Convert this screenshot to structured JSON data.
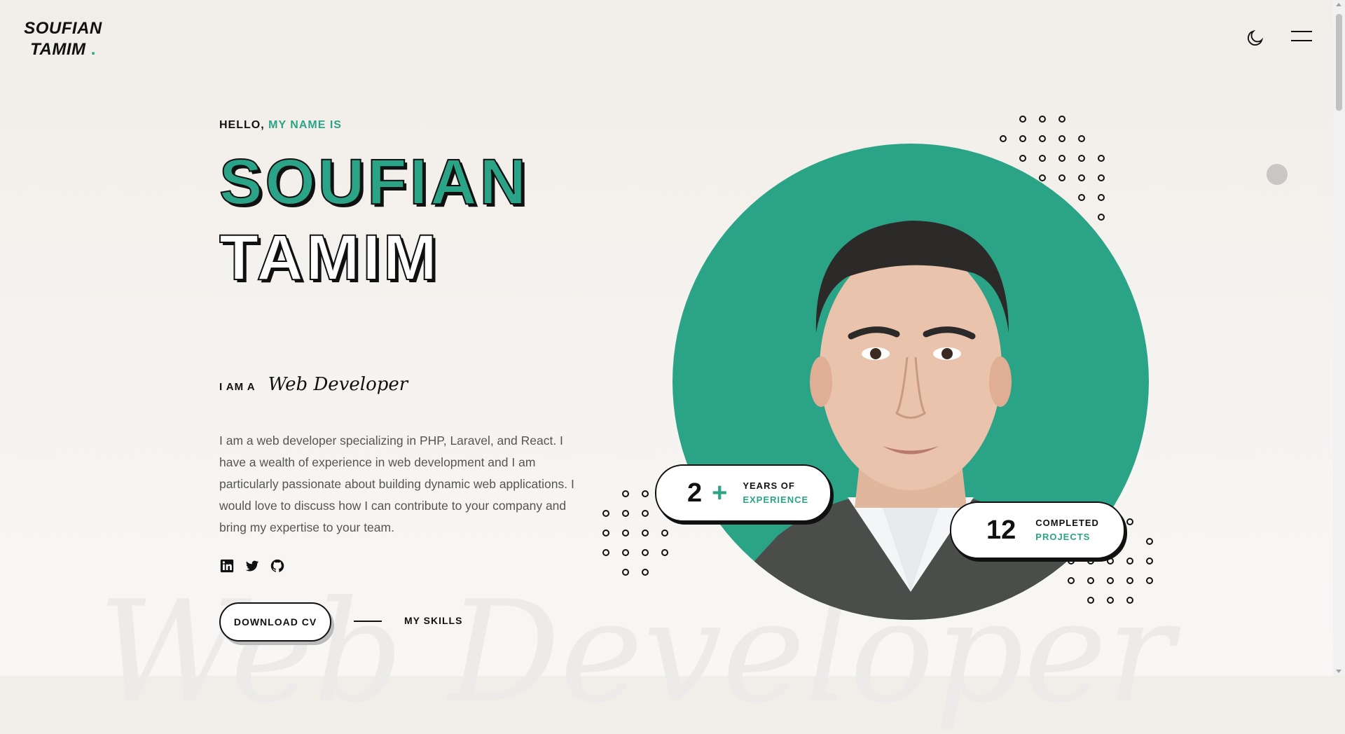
{
  "header": {
    "logo_line1": "SOUFIAN",
    "logo_line2": "TAMIM",
    "logo_dot": ".",
    "theme_icon": "moon-icon",
    "menu_icon": "hamburger-menu-icon"
  },
  "hero": {
    "greeting_prefix": "HELLO,",
    "greeting_accent": "MY NAME IS",
    "first_name": "SOUFIAN",
    "last_name": "TAMIM",
    "role_prefix": "I AM A",
    "role_title": "Web Developer",
    "bio": "I am a web developer specializing in PHP, Laravel, and React. I have a wealth of experience in web development and I am particularly passionate about building dynamic web applications. I would love to discuss how I can contribute to your company and bring my expertise to your team.",
    "socials": [
      "linkedin-icon",
      "twitter-icon",
      "github-icon"
    ],
    "download_cv": "DOWNLOAD CV",
    "my_skills": "MY SKILLS",
    "background_script": "Web Developer"
  },
  "stats": {
    "experience_number": "2",
    "experience_plus": "+",
    "experience_line1": "YEARS OF",
    "experience_line2": "EXPERIENCE",
    "projects_number": "12",
    "projects_line1": "COMPLETED",
    "projects_line2": "PROJECTS"
  },
  "colors": {
    "accent": "#2ba386",
    "text": "#111111",
    "background": "#f3f0ec"
  }
}
